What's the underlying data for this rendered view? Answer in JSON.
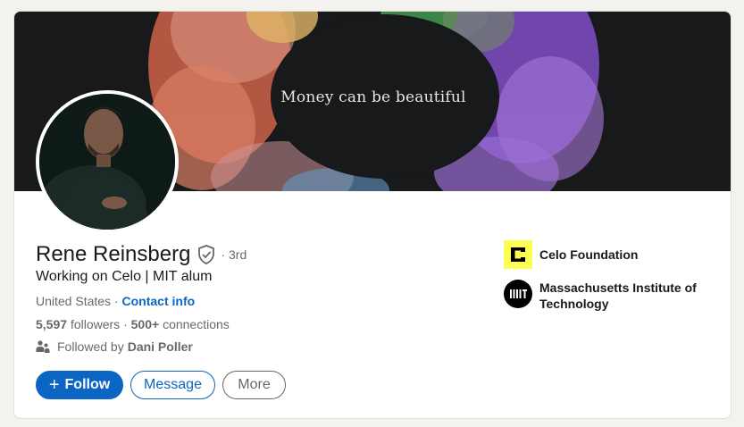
{
  "banner": {
    "tagline": "Money can be beautiful"
  },
  "profile": {
    "name": "Rene Reinsberg",
    "degree": "· 3rd",
    "headline": "Working on Celo | MIT alum",
    "location": "United States",
    "location_sep": " · ",
    "contact_label": "Contact info",
    "followers_count": "5,597",
    "followers_label": "followers",
    "connections_sep": " · ",
    "connections_count": "500+",
    "connections_label": "connections",
    "followed_by_prefix": "Followed by",
    "followed_by_name": "Dani Poller"
  },
  "actions": {
    "follow_icon": "+",
    "follow_label": "Follow",
    "message_label": "Message",
    "more_label": "More"
  },
  "organizations": [
    {
      "name": "Celo Foundation",
      "logo": "celo-logo",
      "logo_bg": "#fcff52"
    },
    {
      "name": "Massachusetts Institute of Technology",
      "logo": "mit-logo",
      "logo_bg": "#000000"
    }
  ],
  "colors": {
    "brand_blue": "#0a66c2",
    "banner_bg": "#18191b",
    "page_bg": "#f3f2ef"
  }
}
